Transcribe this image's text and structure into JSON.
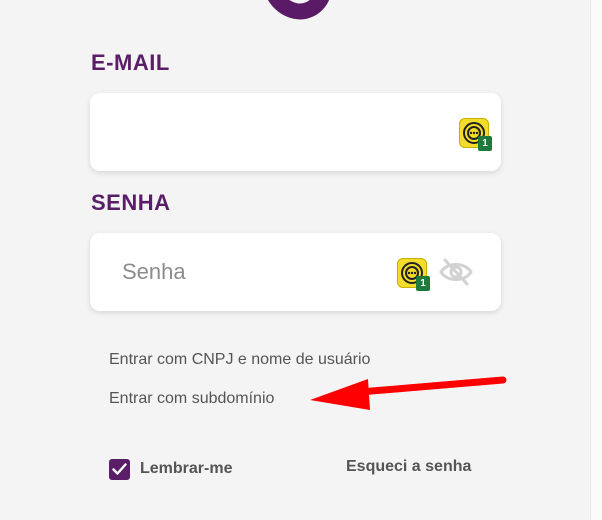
{
  "colors": {
    "brand_purple": "#5a1e68",
    "extension_yellow": "#f4dd2a",
    "badge_green": "#1e7a3a",
    "annotation_red": "#ff0000"
  },
  "email": {
    "label": "E-MAIL",
    "value": "",
    "extension_badge": "1"
  },
  "password": {
    "label": "SENHA",
    "placeholder": "Senha",
    "extension_badge": "1",
    "toggle_icon": "eye-slash-icon"
  },
  "links": {
    "cnpj": "Entrar com CNPJ e nome de usuário",
    "subdomain": "Entrar com subdomínio"
  },
  "remember": {
    "label": "Lembrar-me",
    "checked": true
  },
  "forgot": {
    "label": "Esqueci a senha"
  }
}
